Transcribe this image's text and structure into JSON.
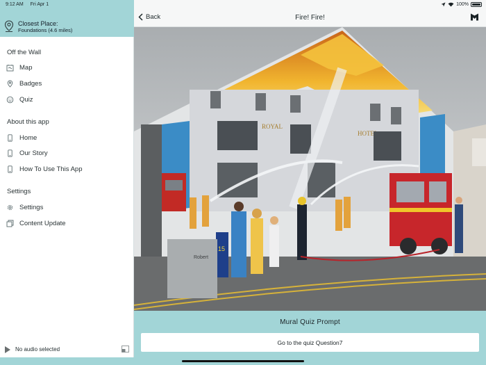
{
  "status_bar": {
    "time": "9:12 AM",
    "date": "Fri Apr 1",
    "battery": "100%"
  },
  "closest_place": {
    "label": "Closest Place:",
    "value": "Foundations (4.6 miles)",
    "icon": "location-pin-icon"
  },
  "sidebar": {
    "sections": [
      {
        "title": "Off the Wall",
        "items": [
          {
            "label": "Map",
            "icon": "map-icon"
          },
          {
            "label": "Badges",
            "icon": "pin-icon"
          },
          {
            "label": "Quiz",
            "icon": "quiz-icon"
          }
        ]
      },
      {
        "title": "About this app",
        "items": [
          {
            "label": "Home",
            "icon": "phone-icon"
          },
          {
            "label": "Our Story",
            "icon": "phone-icon"
          },
          {
            "label": "How To Use This App",
            "icon": "phone-icon"
          }
        ]
      },
      {
        "title": "Settings",
        "items": [
          {
            "label": "Settings",
            "icon": "gear-icon"
          },
          {
            "label": "Content Update",
            "icon": "update-icon"
          }
        ]
      }
    ]
  },
  "player": {
    "status": "No audio selected"
  },
  "navbar": {
    "back_label": "Back",
    "title": "Fire!  Fire!"
  },
  "mural": {
    "sign_royal": "ROYAL",
    "sign_hotel": "HOTEL",
    "engine_number": "15",
    "cabinet_text": "Robert"
  },
  "prompt": {
    "title": "Mural Quiz Prompt",
    "button_label": "Go to the quiz Question7"
  },
  "colors": {
    "accent": "#a2d5d7",
    "navbar_bg": "#f6f7f7"
  }
}
